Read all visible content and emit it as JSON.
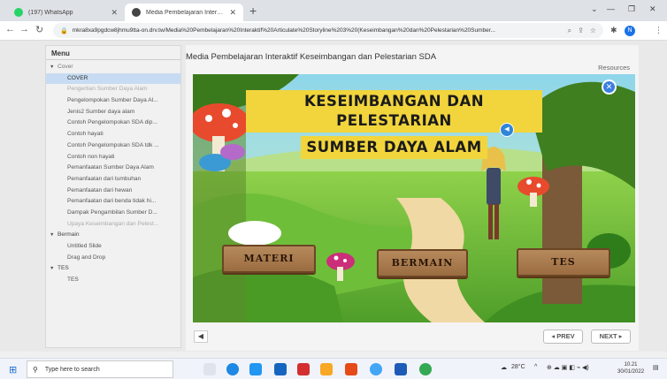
{
  "browser": {
    "tabs": [
      {
        "title": "(197) WhatsApp",
        "favicon_color": "#25d366"
      },
      {
        "title": "Media Pembelajaran Interaktif Ke",
        "favicon_color": "#444444"
      }
    ],
    "address_bar": "mkra8xa9pgdcw8jhmu9tta-on.drv.tw/Media%20Pembelajaran%20Interaktif%20Articulate%20Storyline%203%20(Keseimbangan%20dan%20Pelestarian%20Sumber...",
    "profile_initial": "N"
  },
  "menu": {
    "header": "Menu",
    "groups": [
      {
        "label": "Cover",
        "items": [
          {
            "label": "COVER",
            "selected": true
          },
          {
            "label": "Pengertian Sumber Daya Alam",
            "dim": true
          },
          {
            "label": "Pengelompokan Sumber Daya Al..."
          },
          {
            "label": "Jenis2 Sumber daya alam"
          },
          {
            "label": "Contoh Pengelompokan SDA dip..."
          },
          {
            "label": "Contoh hayati"
          },
          {
            "label": "Contoh Pengelompokan SDA tdk ..."
          },
          {
            "label": "Contoh non hayati"
          },
          {
            "label": "Pemanfaatan Sumber Daya Alam"
          },
          {
            "label": "Pemanfaatan dari tumbuhan"
          },
          {
            "label": "Pemanfaatan dari hewan"
          },
          {
            "label": "Pemanfaatan dari benda tidak hi..."
          },
          {
            "label": "Dampak Pengambilan Sumber D..."
          },
          {
            "label": "Upaya Keseimbangan dan Pelest...",
            "dim": true
          }
        ]
      },
      {
        "label": "Bermain",
        "items": [
          {
            "label": "Untitled Slide"
          },
          {
            "label": "Drag and Drop"
          }
        ]
      },
      {
        "label": "TES",
        "items": [
          {
            "label": "TES"
          }
        ]
      }
    ]
  },
  "slide": {
    "course_title": "Media Pembelajaran Interaktif Keseimbangan dan Pelestarian SDA",
    "resources_label": "Resources",
    "title_line1": "KESEIMBANGAN DAN PELESTARIAN",
    "title_line2": "SUMBER DAYA ALAM",
    "buttons": {
      "materi": "MATERI",
      "bermain": "BERMAIN",
      "tes": "TES"
    },
    "prev_label": "◂ PREV",
    "next_label": "NEXT ▸"
  },
  "taskbar": {
    "search_placeholder": "Type here to search",
    "weather": "28°C",
    "time": "10.21",
    "date": "30/01/2022"
  },
  "colors": {
    "title_banner": "#f2d53c",
    "menu_selected": "#c7dcf2",
    "sign_wood": "#a8794b",
    "close_button": "#3a7fe0"
  }
}
